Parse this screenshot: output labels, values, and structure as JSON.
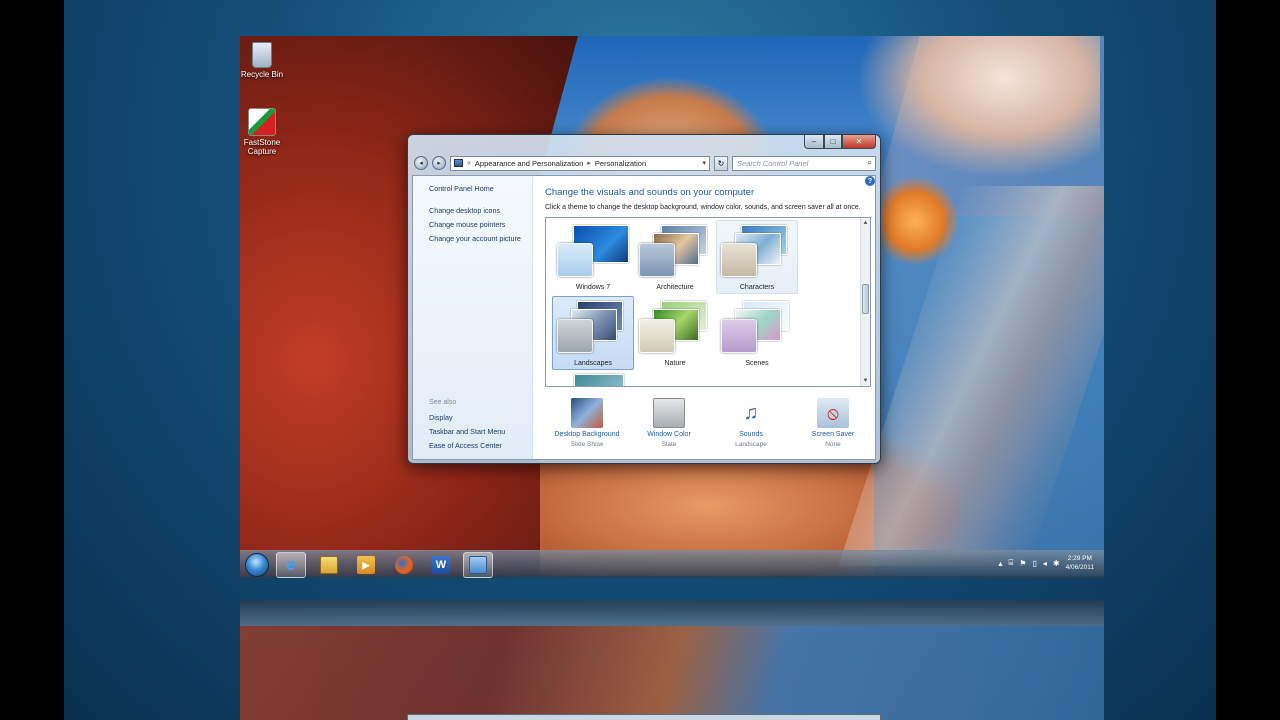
{
  "desktop": {
    "icons": [
      {
        "label": "Recycle Bin",
        "icon": "recycle-bin-icon"
      },
      {
        "label": "FastStone Capture",
        "icon": "faststone-capture-icon"
      }
    ]
  },
  "window": {
    "controls": {
      "minimize": "–",
      "maximize": "□",
      "close": "✕"
    },
    "address": {
      "root_icon": "control-panel-icon",
      "overflow": "«",
      "crumb1": "Appearance and Personalization",
      "separator": "▸",
      "crumb2": "Personalization"
    },
    "search_placeholder": "Search Control Panel",
    "left_pane": {
      "home": "Control Panel Home",
      "links": [
        "Change desktop icons",
        "Change mouse pointers",
        "Change your account picture"
      ],
      "see_also_heading": "See also",
      "see_also": [
        "Display",
        "Taskbar and Start Menu",
        "Ease of Access Center"
      ]
    },
    "main": {
      "title": "Change the visuals and sounds on your computer",
      "subtitle": "Click a theme to change the desktop background, window color, sounds, and screen saver all at once.",
      "themes": [
        {
          "label": "Windows 7",
          "state": "normal"
        },
        {
          "label": "Architecture",
          "state": "normal"
        },
        {
          "label": "Characters",
          "state": "hover"
        },
        {
          "label": "Landscapes",
          "state": "selected"
        },
        {
          "label": "Nature",
          "state": "normal"
        },
        {
          "label": "Scenes",
          "state": "normal"
        }
      ],
      "bottom": [
        {
          "label": "Desktop Background",
          "sub": "Slide Show"
        },
        {
          "label": "Window Color",
          "sub": "Slate"
        },
        {
          "label": "Sounds",
          "sub": "Landscape"
        },
        {
          "label": "Screen Saver",
          "sub": "None"
        }
      ]
    }
  },
  "taskbar": {
    "items": [
      "internet-explorer-icon",
      "windows-explorer-icon",
      "media-player-icon",
      "firefox-icon",
      "word-icon",
      "control-panel-icon"
    ],
    "word_glyph": "W",
    "ie_glyph": "e",
    "clock": {
      "time": "2:29 PM",
      "date": "4/06/2011"
    }
  },
  "colors": {
    "link": "#1e5aa8",
    "heading": "#1e5aa8",
    "selection": "#c5dcf5"
  }
}
